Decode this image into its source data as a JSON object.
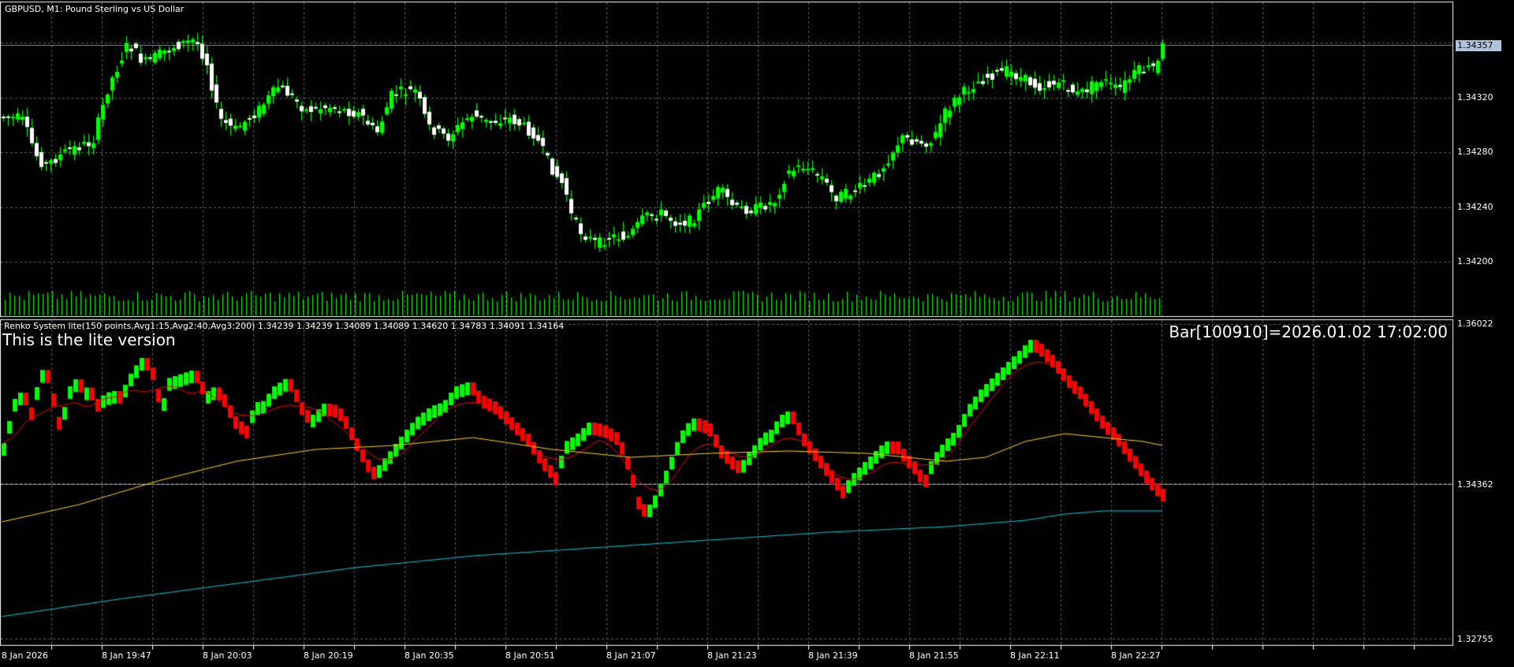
{
  "main_chart": {
    "title": "GBPUSD, M1:  Pound Sterling vs US Dollar",
    "price_labels": [
      "1.34320",
      "1.34280",
      "1.34240",
      "1.34200"
    ],
    "current_price": "1.34357",
    "bull_color": "#00ff00",
    "bear_candle_color": "#ffffff",
    "volume_color": "#00ff00"
  },
  "indicator": {
    "title": "Renko System lite(150 points,Avg1:15,Avg2:40,Avg3:200) 1.34239 1.34239 1.34089 1.34089 1.34620 1.34783 1.34091 1.34164",
    "lite_notice": "This is the lite version",
    "bar_info": "Bar[100910]=2026.01.02 17:02:00",
    "price_labels": [
      "1.36022",
      "1.34362",
      "1.32755"
    ],
    "colors": {
      "up_brick": "#00ff00",
      "down_brick": "#ff0000",
      "avg1": "#ff0000",
      "avg2": "#ffd700",
      "avg3": "#00ced1"
    }
  },
  "x_axis": {
    "labels": [
      "8 Jan 2026",
      "8 Jan 19:47",
      "8 Jan 20:03",
      "8 Jan 20:19",
      "8 Jan 20:35",
      "8 Jan 20:51",
      "8 Jan 21:07",
      "8 Jan 21:23",
      "8 Jan 21:39",
      "8 Jan 21:55",
      "8 Jan 22:11",
      "8 Jan 22:27"
    ]
  }
}
